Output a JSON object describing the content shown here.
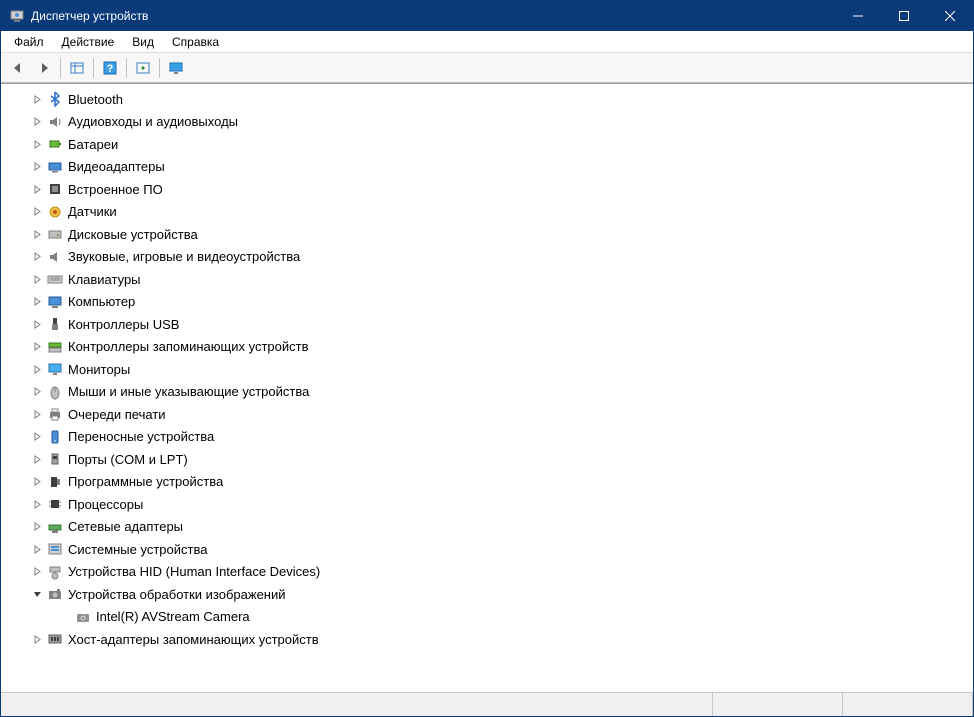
{
  "window": {
    "title": "Диспетчер устройств"
  },
  "menu": {
    "file": "Файл",
    "action": "Действие",
    "view": "Вид",
    "help": "Справка"
  },
  "tree": {
    "items": [
      {
        "icon": "bluetooth",
        "label": "Bluetooth",
        "expanded": false
      },
      {
        "icon": "audio",
        "label": "Аудиовходы и аудиовыходы",
        "expanded": false
      },
      {
        "icon": "battery",
        "label": "Батареи",
        "expanded": false
      },
      {
        "icon": "display-adapter",
        "label": "Видеоадаптеры",
        "expanded": false
      },
      {
        "icon": "firmware",
        "label": "Встроенное ПО",
        "expanded": false
      },
      {
        "icon": "sensor",
        "label": "Датчики",
        "expanded": false
      },
      {
        "icon": "disk",
        "label": "Дисковые устройства",
        "expanded": false
      },
      {
        "icon": "sound",
        "label": "Звуковые, игровые и видеоустройства",
        "expanded": false
      },
      {
        "icon": "keyboard",
        "label": "Клавиатуры",
        "expanded": false
      },
      {
        "icon": "computer",
        "label": "Компьютер",
        "expanded": false
      },
      {
        "icon": "usb",
        "label": "Контроллеры USB",
        "expanded": false
      },
      {
        "icon": "storage-ctrl",
        "label": "Контроллеры запоминающих устройств",
        "expanded": false
      },
      {
        "icon": "monitor",
        "label": "Мониторы",
        "expanded": false
      },
      {
        "icon": "mouse",
        "label": "Мыши и иные указывающие устройства",
        "expanded": false
      },
      {
        "icon": "print-queue",
        "label": "Очереди печати",
        "expanded": false
      },
      {
        "icon": "portable",
        "label": "Переносные устройства",
        "expanded": false
      },
      {
        "icon": "port",
        "label": "Порты (COM и LPT)",
        "expanded": false
      },
      {
        "icon": "software",
        "label": "Программные устройства",
        "expanded": false
      },
      {
        "icon": "cpu",
        "label": "Процессоры",
        "expanded": false
      },
      {
        "icon": "network",
        "label": "Сетевые адаптеры",
        "expanded": false
      },
      {
        "icon": "system",
        "label": "Системные устройства",
        "expanded": false
      },
      {
        "icon": "hid",
        "label": "Устройства HID (Human Interface Devices)",
        "expanded": false
      },
      {
        "icon": "imaging",
        "label": "Устройства обработки изображений",
        "expanded": true,
        "children": [
          {
            "icon": "camera",
            "label": "Intel(R) AVStream Camera"
          }
        ]
      },
      {
        "icon": "host-adapter",
        "label": "Хост-адаптеры запоминающих устройств",
        "expanded": false
      }
    ]
  }
}
